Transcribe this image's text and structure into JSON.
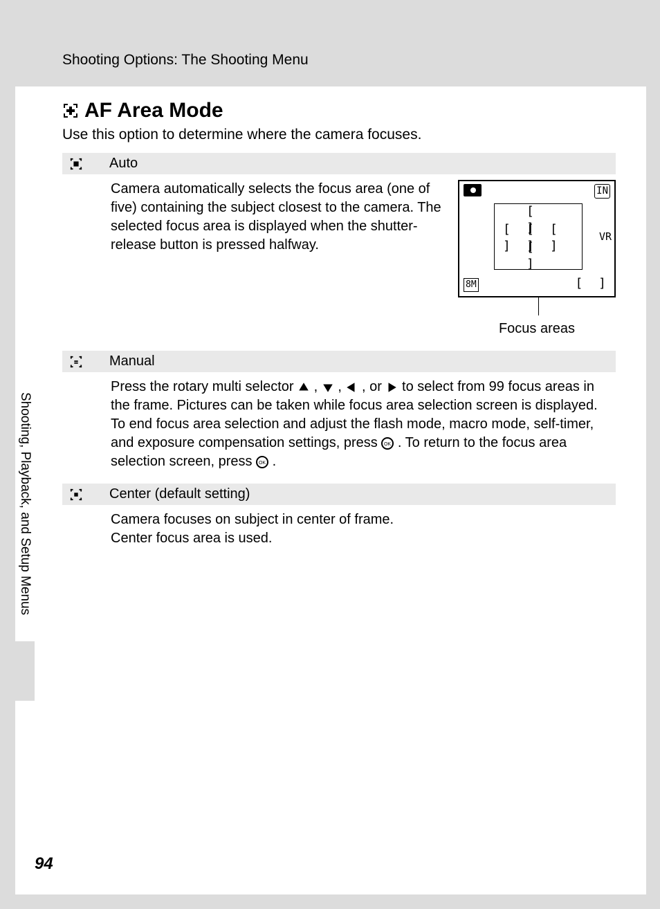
{
  "header": {
    "breadcrumb": "Shooting Options: The Shooting Menu"
  },
  "title": "AF Area Mode",
  "intro": "Use this option to determine where the camera focuses.",
  "sections": {
    "auto": {
      "label": "Auto",
      "body": "Camera automatically selects the focus area (one of five) containing the subject closest to the camera. The selected focus area is displayed when the shutter-release button is pressed halfway.",
      "figure_caption": "Focus areas",
      "lcd": {
        "tr": "IN",
        "mr": "VR",
        "bl": "8M",
        "br": "[  ]"
      }
    },
    "manual": {
      "label": "Manual",
      "body_1": "Press the rotary multi selector ",
      "body_2": ", ",
      "body_3": ", ",
      "body_4": ", or ",
      "body_5": " to select from 99 focus areas in the frame. Pictures can be taken while focus area selection screen is displayed.",
      "body_6": "To end focus area selection and adjust the flash mode, macro mode, self-timer, and exposure compensation settings, press ",
      "body_7": ". To return to the focus area selection screen, press ",
      "body_8": "."
    },
    "center": {
      "label": "Center (default setting)",
      "body_1": "Camera focuses on subject in center of frame.",
      "body_2": "Center focus area is used."
    }
  },
  "side_tab": "Shooting, Playback, and Setup Menus",
  "page_number": "94"
}
